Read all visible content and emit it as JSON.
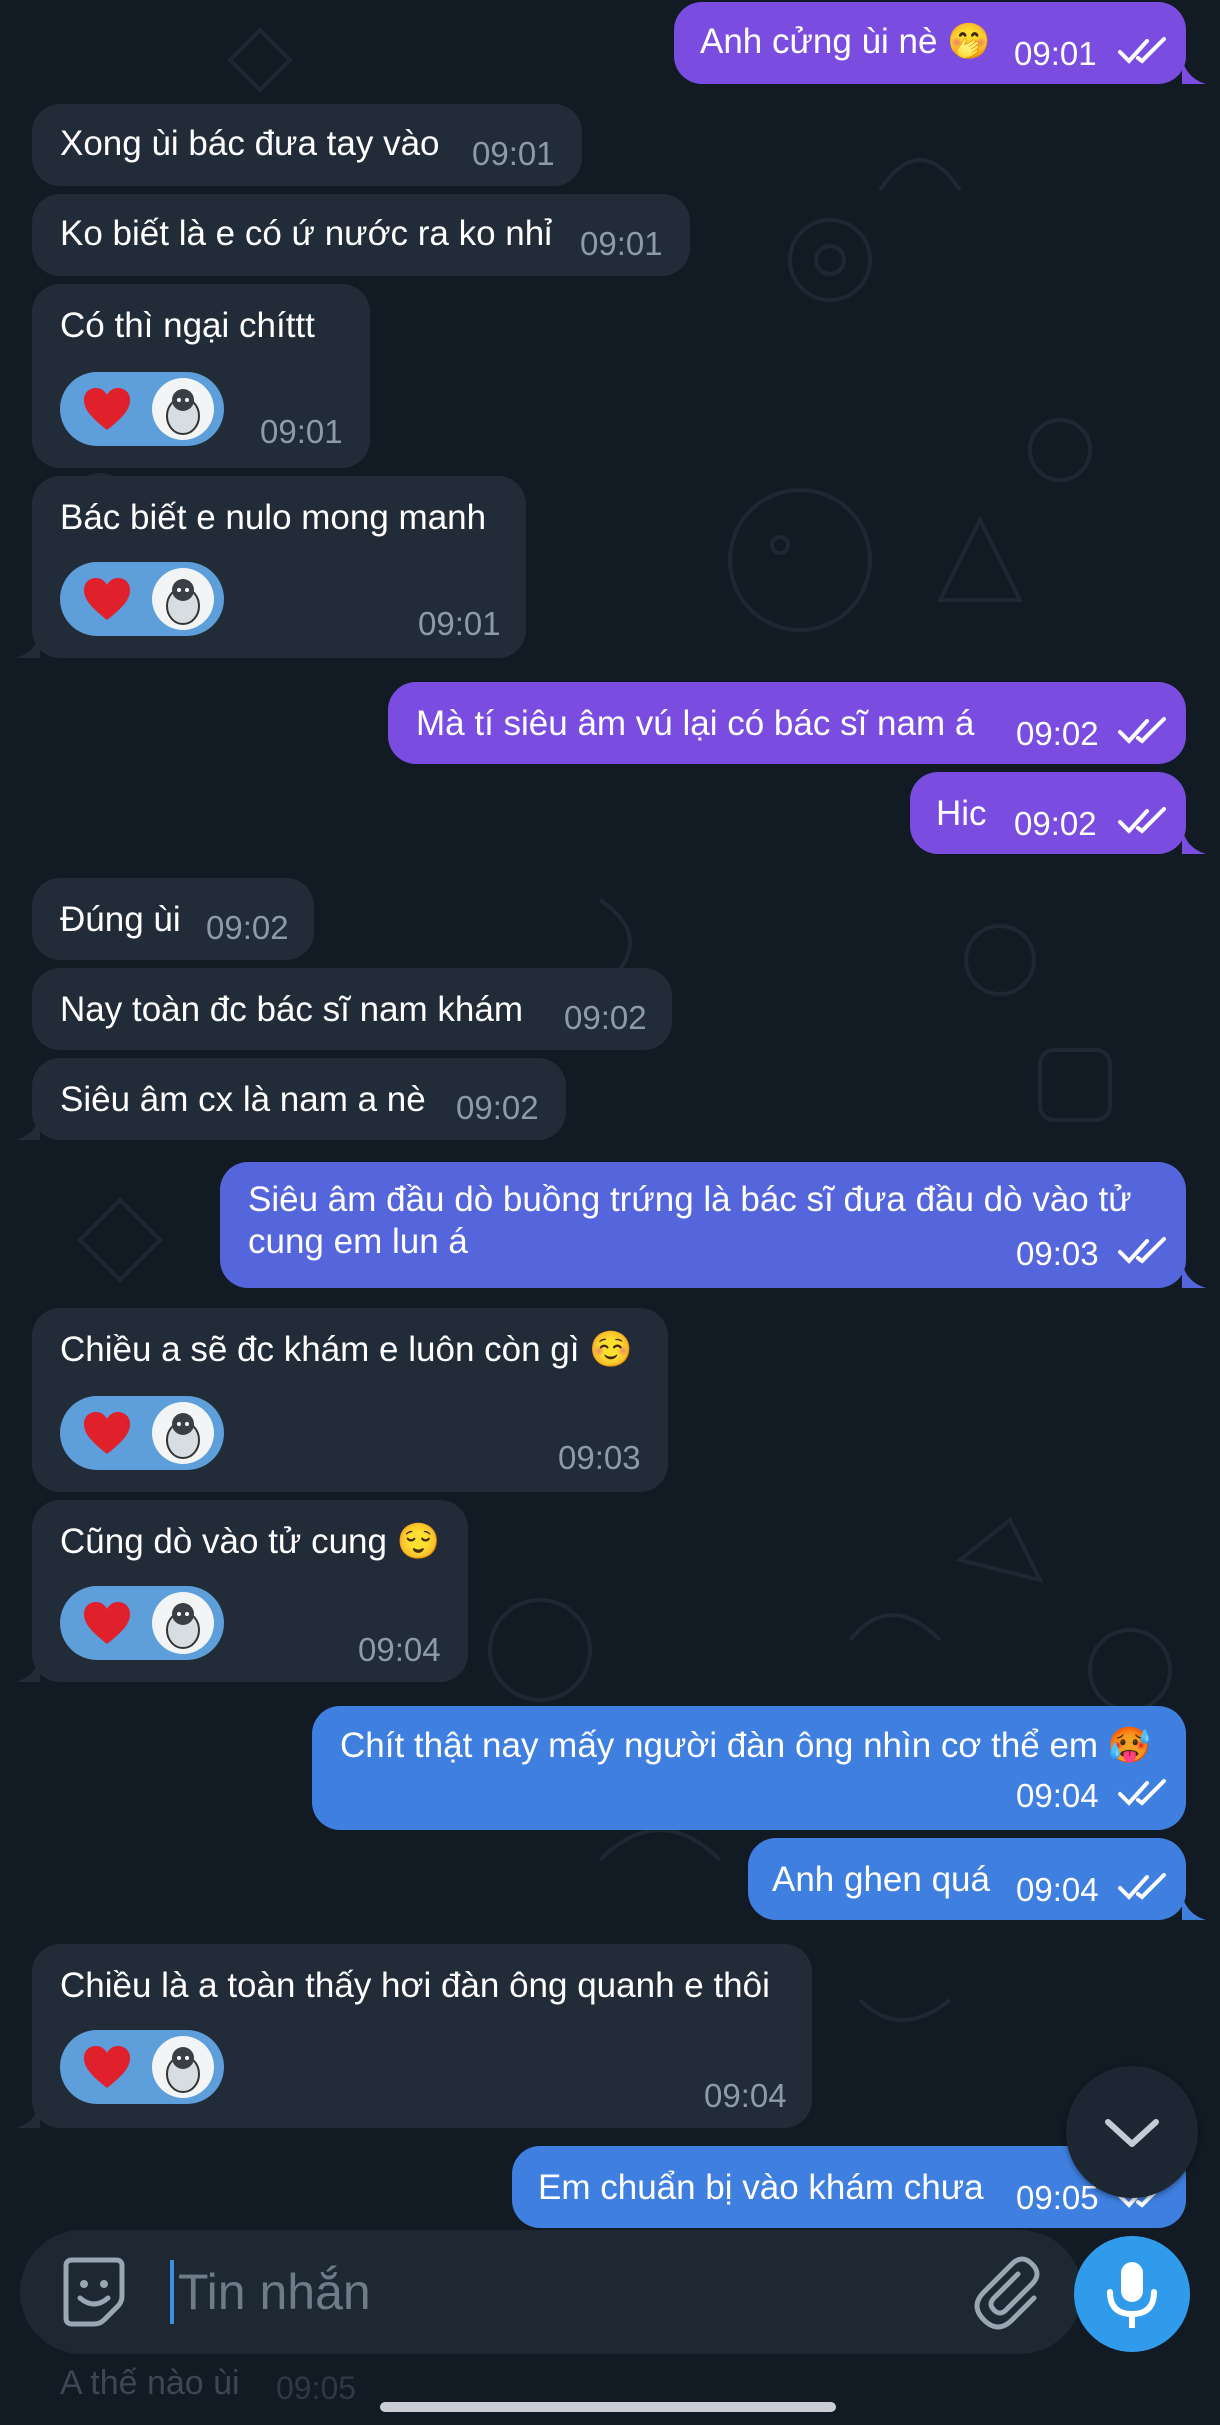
{
  "colors": {
    "background": "#121a23",
    "incoming_bubble": "#222c38",
    "outgoing_purple": "#7a4de0",
    "outgoing_indigo": "#5566dd",
    "outgoing_blue": "#3f7fe0",
    "reaction_pill": "#5d9edb",
    "mic_button": "#2f9bea"
  },
  "messages": [
    {
      "text": "Anh cửng ùi nè 🤭",
      "time": "09:01",
      "direction": "out"
    },
    {
      "text": "Xong ùi bác đưa tay vào",
      "time": "09:01",
      "direction": "in"
    },
    {
      "text": "Ko biết là e có ứ nước ra ko nhỉ",
      "time": "09:01",
      "direction": "in"
    },
    {
      "text": "Có thì ngại chíttt",
      "time": "09:01",
      "direction": "in",
      "reaction": "heart"
    },
    {
      "text": "Bác biết e nulo mong manh",
      "time": "09:01",
      "direction": "in",
      "reaction": "heart"
    },
    {
      "text": "Mà tí siêu âm vú lại có bác sĩ nam á",
      "time": "09:02",
      "direction": "out"
    },
    {
      "text": "Hic",
      "time": "09:02",
      "direction": "out"
    },
    {
      "text": "Đúng ùi",
      "time": "09:02",
      "direction": "in"
    },
    {
      "text": "Nay toàn đc bác sĩ nam khám",
      "time": "09:02",
      "direction": "in"
    },
    {
      "text": "Siêu âm cx là nam a nè",
      "time": "09:02",
      "direction": "in"
    },
    {
      "text_line1": "Siêu âm đầu dò buồng trứng là bác sĩ đưa đầu dò vào tử",
      "text_line2": "cung em lun á",
      "time": "09:03",
      "direction": "out"
    },
    {
      "text": "Chiều a sẽ đc khám e luôn còn gì ☺️",
      "time": "09:03",
      "direction": "in",
      "reaction": "heart"
    },
    {
      "text": "Cũng dò vào tử cung 😌",
      "time": "09:04",
      "direction": "in",
      "reaction": "heart"
    },
    {
      "text": "Chít thật nay mấy người đàn ông nhìn cơ thể em 🥵",
      "time": "09:04",
      "direction": "out"
    },
    {
      "text": "Anh ghen quá",
      "time": "09:04",
      "direction": "out"
    },
    {
      "text": "Chiều là a toàn thấy hơi đàn ông quanh e thôi",
      "time": "09:04",
      "direction": "in",
      "reaction": "heart"
    },
    {
      "text": "Em chuẩn bị vào khám chưa",
      "time": "09:05",
      "direction": "out"
    }
  ],
  "composer": {
    "placeholder": "Tin nhắn",
    "hidden_preview_text": "A thế nào ùi",
    "hidden_preview_time": "09:05"
  },
  "icons": {
    "sticker": "sticker-smiley-icon",
    "attach": "paperclip-icon",
    "mic": "microphone-icon",
    "scroll_down": "chevron-down-icon",
    "read_receipt": "double-check-icon",
    "reaction": "red-heart-icon"
  }
}
